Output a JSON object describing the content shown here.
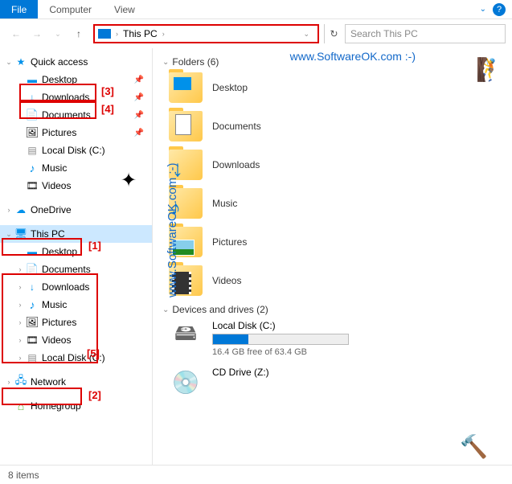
{
  "menubar": {
    "file": "File",
    "computer": "Computer",
    "view": "View"
  },
  "nav": {
    "address_label": "This PC",
    "search_placeholder": "Search This PC"
  },
  "sidebar": {
    "quick_access": "Quick access",
    "qa_items": [
      {
        "label": "Desktop",
        "icon": "ic-desktop",
        "pin": true
      },
      {
        "label": "Downloads",
        "icon": "ic-dl",
        "pin": true
      },
      {
        "label": "Documents",
        "icon": "ic-doc",
        "pin": true
      },
      {
        "label": "Pictures",
        "icon": "ic-pic",
        "pin": true
      },
      {
        "label": "Local Disk (C:)",
        "icon": "ic-disk",
        "pin": false
      },
      {
        "label": "Music",
        "icon": "ic-music",
        "pin": false
      },
      {
        "label": "Videos",
        "icon": "ic-video",
        "pin": false
      }
    ],
    "onedrive": "OneDrive",
    "this_pc": "This PC",
    "pc_items": [
      {
        "label": "Desktop",
        "icon": "ic-desktop"
      },
      {
        "label": "Documents",
        "icon": "ic-doc"
      },
      {
        "label": "Downloads",
        "icon": "ic-dl"
      },
      {
        "label": "Music",
        "icon": "ic-music"
      },
      {
        "label": "Pictures",
        "icon": "ic-pic"
      },
      {
        "label": "Videos",
        "icon": "ic-video"
      },
      {
        "label": "Local Disk (C:)",
        "icon": "ic-disk"
      }
    ],
    "network": "Network",
    "homegroup": "Homegroup"
  },
  "content": {
    "folders_header": "Folders (6)",
    "folders": [
      {
        "label": "Desktop",
        "overlay": ""
      },
      {
        "label": "Documents",
        "overlay": ""
      },
      {
        "label": "Downloads",
        "overlay": "↓"
      },
      {
        "label": "Music",
        "overlay": "♪"
      },
      {
        "label": "Pictures",
        "overlay": ""
      },
      {
        "label": "Videos",
        "overlay": ""
      }
    ],
    "drives_header": "Devices and drives (2)",
    "drives": [
      {
        "label": "Local Disk (C:)",
        "sub": "16.4 GB free of 63.4 GB",
        "fill": 26,
        "icon": "🖴"
      },
      {
        "label": "CD Drive (Z:)",
        "sub": "",
        "fill": 0,
        "icon": "💿"
      }
    ]
  },
  "status": {
    "items": "8 items"
  },
  "annotations": {
    "a1": "[1]",
    "a2": "[2]",
    "a3": "[3]",
    "a4": "[4]",
    "a5": "[5]"
  },
  "watermark": "www.SoftwareOK.com  :-)"
}
